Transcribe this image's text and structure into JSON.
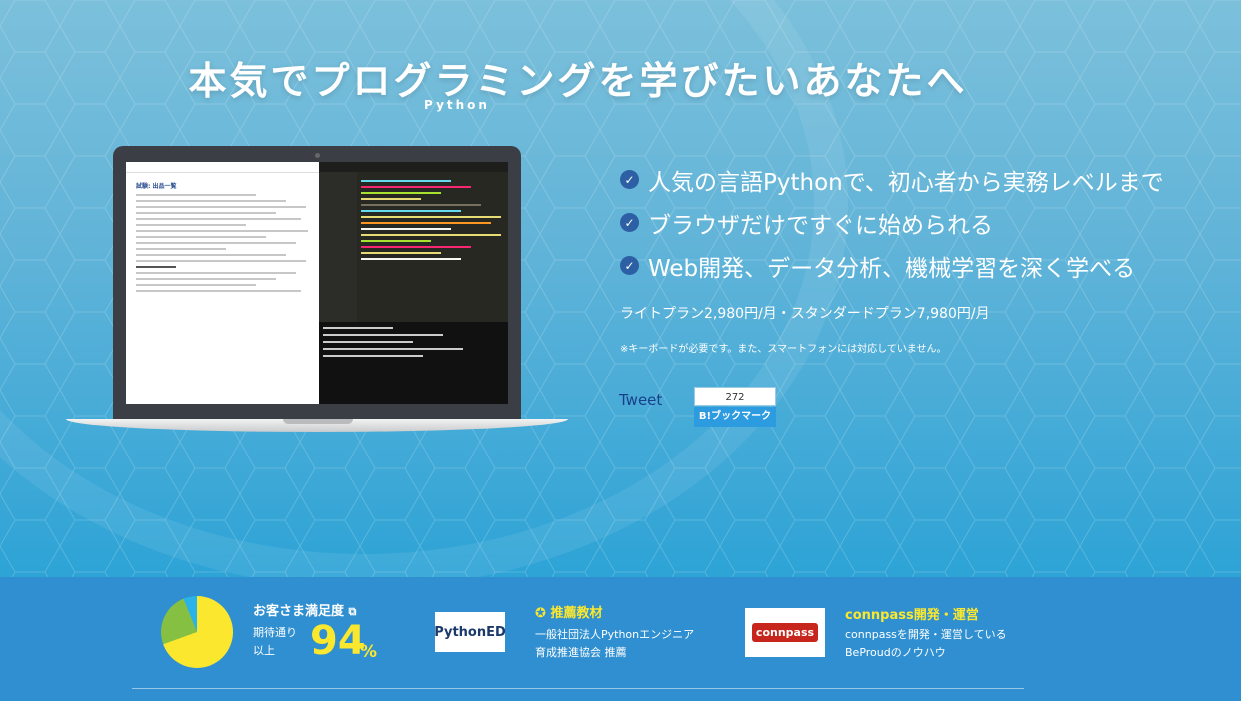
{
  "hero": {
    "title": "本気でプログラミングを学びたいあなたへ",
    "subtitle": "Python",
    "bullets": [
      "人気の言語Pythonで、初心者から実務レベルまで",
      "ブラウザだけですぐに始められる",
      "Web開発、データ分析、機械学習を深く学べる"
    ],
    "price": "ライトプラン2,980円/月・スタンダードプラン7,980円/月",
    "note": "※キーボードが必要です。また、スマートフォンには対応していません。",
    "tweet": "Tweet",
    "hatena_count": "272",
    "hatena_label": "B!ブックマーク"
  },
  "screen": {
    "lesson_title": "試験: 出品一覧"
  },
  "footer": {
    "satisfaction": {
      "title": "お客さま満足度",
      "sub_line1": "期待通り",
      "sub_line2": "以上",
      "value": "94",
      "unit": "%"
    },
    "recommend": {
      "logo": "PythonED",
      "title": "推薦教材",
      "body": "一般社団法人Pythonエンジニア育成推進協会 推薦"
    },
    "connpass": {
      "logo": "connpass",
      "title": "connpass開発・運営",
      "body": "connpassを開発・運営しているBeProudのノウハウ"
    }
  },
  "colors": {
    "accent_yellow": "#fbe82e",
    "footer_bg": "#2f8fd0",
    "check_bg": "#2d5fa5"
  }
}
